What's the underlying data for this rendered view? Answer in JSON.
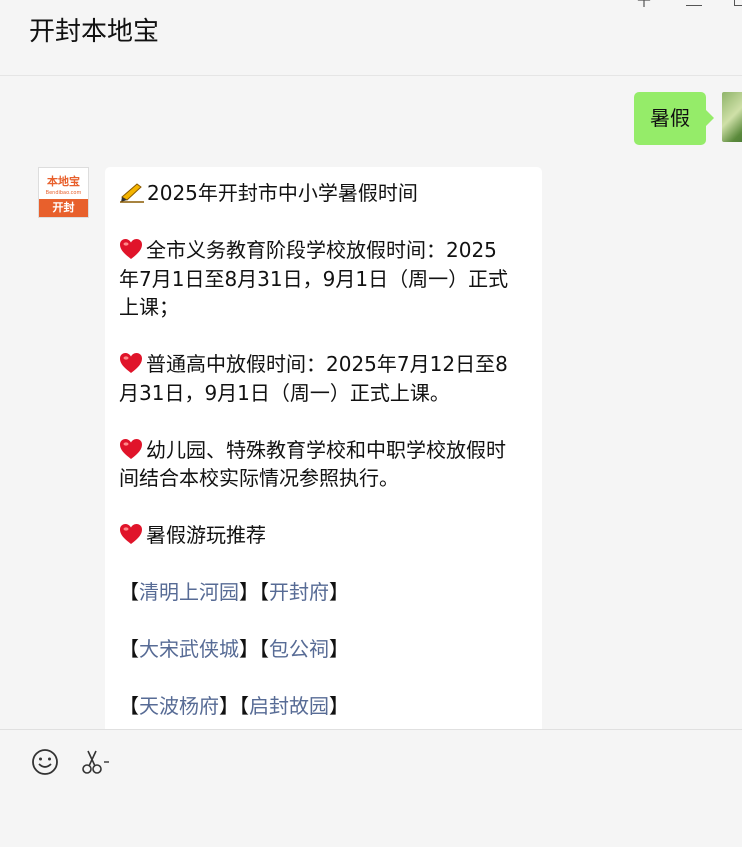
{
  "header": {
    "title": "开封本地宝"
  },
  "messages": {
    "outgoing": {
      "text": "暑假"
    },
    "incoming_avatar": {
      "name": "本地宝",
      "url": "Bendibao.com",
      "city": "开封"
    },
    "incoming": {
      "title": "2025年开封市中小学暑假时间",
      "p1_line1": "全市义务教育阶段学校放假时间：2025",
      "p1_line2": "年7月1日至8月31日，9月1日（周一）正式",
      "p1_line3": "上课；",
      "p2_line1": "普通高中放假时间：2025年7月12日至8",
      "p2_line2": "月31日，9月1日（周一）正式上课。",
      "p3_line1": "幼儿园、特殊教育学校和中职学校放假时",
      "p3_line2": "间结合本校实际情况参照执行。",
      "p4": "暑假游玩推荐",
      "links": [
        [
          "清明上河园",
          "开封府"
        ],
        [
          "大宋武侠城",
          "包公祠"
        ],
        [
          "天波杨府",
          "启封故园"
        ]
      ],
      "bracket_open": "【",
      "bracket_close": "】"
    }
  },
  "toolbar": {
    "icons": [
      "emoji-icon",
      "screenshot-scissors-icon"
    ]
  },
  "colors": {
    "outgoing_bubble": "#95ec69",
    "link": "#576b95",
    "brand": "#e8602c",
    "heart": "#e0142a"
  }
}
